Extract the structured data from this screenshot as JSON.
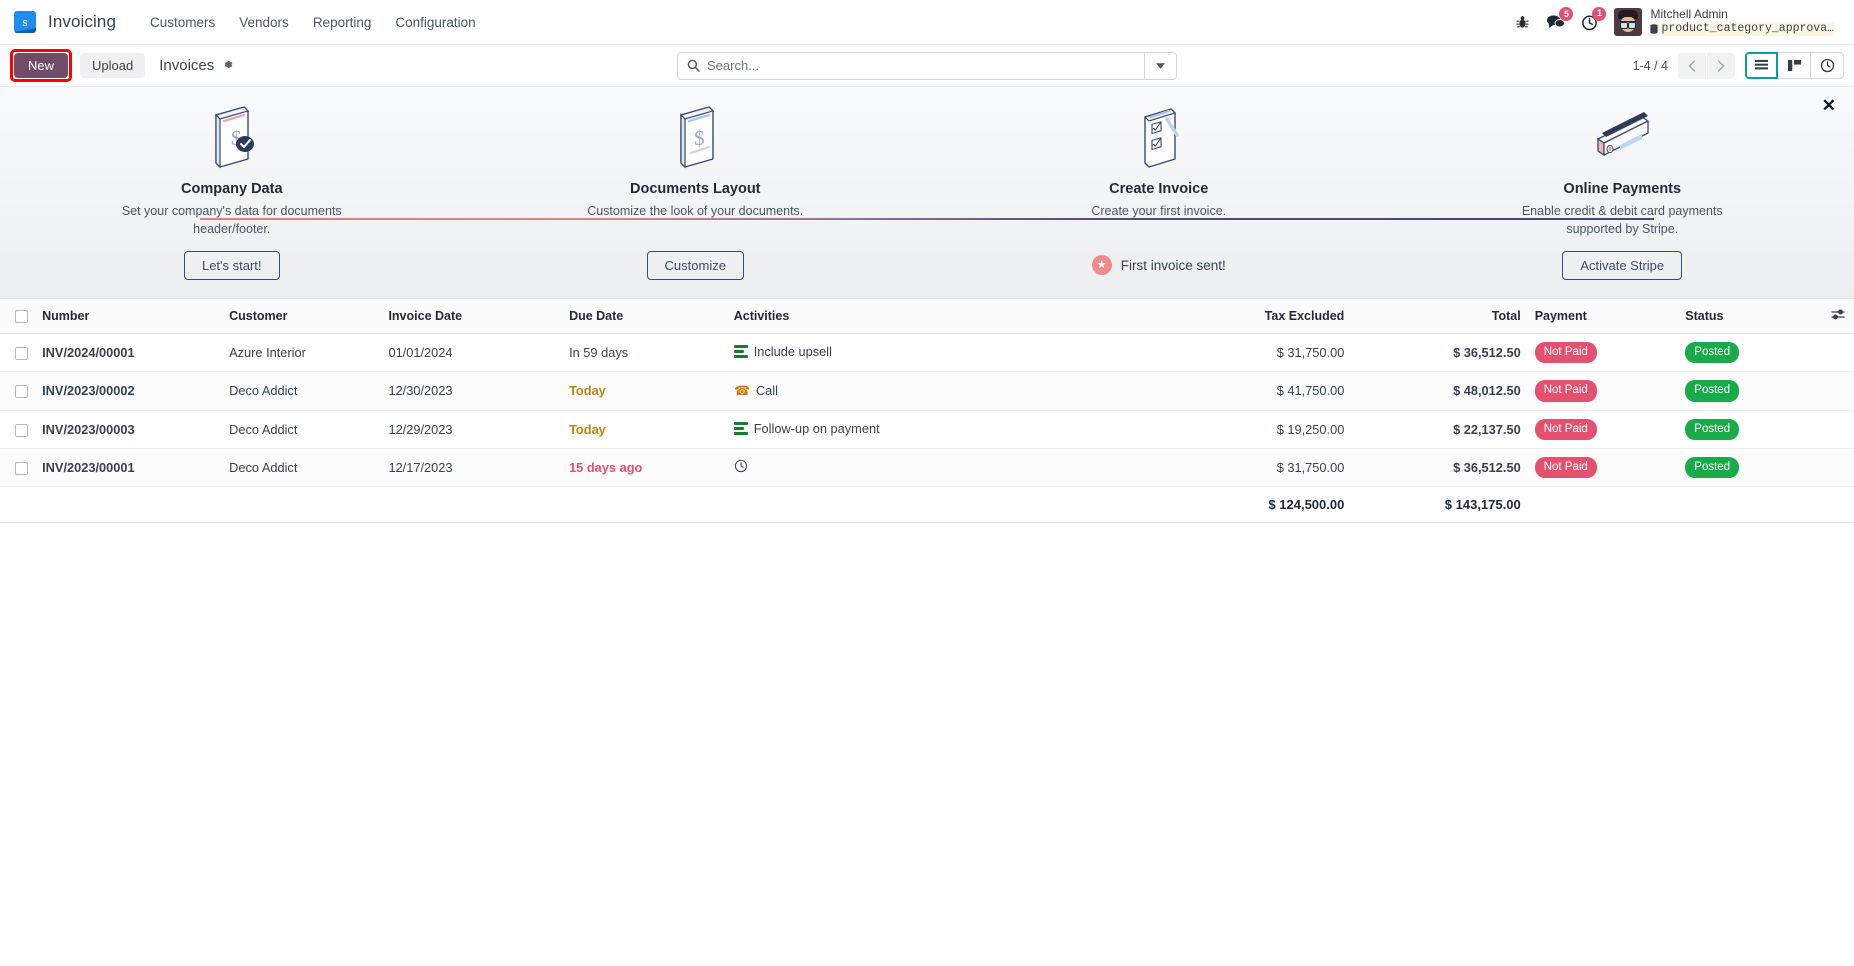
{
  "navbar": {
    "logo_letter": "s",
    "app_name": "Invoicing",
    "menu": [
      {
        "label": "Customers"
      },
      {
        "label": "Vendors"
      },
      {
        "label": "Reporting"
      },
      {
        "label": "Configuration"
      }
    ],
    "bug_icon": "bug-icon",
    "messages_count": "5",
    "activities_count": "1",
    "user_name": "Mitchell Admin",
    "user_database": "product_category_approva…"
  },
  "control_panel": {
    "new_label": "New",
    "upload_label": "Upload",
    "breadcrumb": "Invoices",
    "gear_icon": "gear-icon",
    "search_placeholder": "Search...",
    "pager": "1-4 / 4",
    "views": [
      {
        "name": "list",
        "active": true
      },
      {
        "name": "kanban",
        "active": false
      },
      {
        "name": "activity",
        "active": false
      }
    ]
  },
  "onboarding": {
    "close_label": "✕",
    "steps": [
      {
        "title": "Company Data",
        "desc": "Set your company's data for documents header/footer.",
        "button": "Let's start!",
        "done": false,
        "icon": "company-data-illustration"
      },
      {
        "title": "Documents Layout",
        "desc": "Customize the look of your documents.",
        "button": "Customize",
        "done": false,
        "icon": "documents-layout-illustration"
      },
      {
        "title": "Create Invoice",
        "desc": "Create your first invoice.",
        "done": true,
        "done_label": "First invoice sent!",
        "icon": "create-invoice-illustration"
      },
      {
        "title": "Online Payments",
        "desc": "Enable credit & debit card payments supported by Stripe.",
        "button": "Activate Stripe",
        "done": false,
        "icon": "online-payments-illustration"
      }
    ]
  },
  "list": {
    "columns": [
      "Number",
      "Customer",
      "Invoice Date",
      "Due Date",
      "Activities",
      "Tax Excluded",
      "Total",
      "Payment",
      "Status"
    ],
    "rows": [
      {
        "number": "INV/2024/00001",
        "customer": "Azure Interior",
        "invoice_date": "01/01/2024",
        "due_date": "In 59 days",
        "due_state": "normal",
        "activity": "Include upsell",
        "activity_icon": "todo-list-icon",
        "tax_excluded": "$ 31,750.00",
        "total": "$ 36,512.50",
        "payment": "Not Paid",
        "status": "Posted"
      },
      {
        "number": "INV/2023/00002",
        "customer": "Deco Addict",
        "invoice_date": "12/30/2023",
        "due_date": "Today",
        "due_state": "today",
        "activity": "Call",
        "activity_icon": "phone-icon",
        "tax_excluded": "$ 41,750.00",
        "total": "$ 48,012.50",
        "payment": "Not Paid",
        "status": "Posted"
      },
      {
        "number": "INV/2023/00003",
        "customer": "Deco Addict",
        "invoice_date": "12/29/2023",
        "due_date": "Today",
        "due_state": "today",
        "activity": "Follow-up on payment",
        "activity_icon": "todo-list-icon",
        "tax_excluded": "$ 19,250.00",
        "total": "$ 22,137.50",
        "payment": "Not Paid",
        "status": "Posted"
      },
      {
        "number": "INV/2023/00001",
        "customer": "Deco Addict",
        "invoice_date": "12/17/2023",
        "due_date": "15 days ago",
        "due_state": "late",
        "activity": "",
        "activity_icon": "clock-icon",
        "tax_excluded": "$ 31,750.00",
        "total": "$ 36,512.50",
        "payment": "Not Paid",
        "status": "Posted"
      }
    ],
    "totals": {
      "tax_excluded": "$ 124,500.00",
      "total": "$ 143,175.00"
    }
  },
  "colors": {
    "brand_purple": "#714b67",
    "danger": "#e4506e",
    "success": "#19ab4a",
    "highlight_box": "#ff0000",
    "logo_blue": "#1f8ded"
  }
}
